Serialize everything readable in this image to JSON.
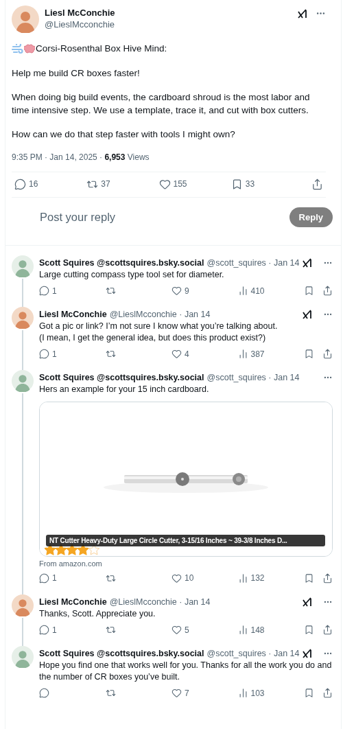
{
  "post": {
    "author": {
      "name": "Liesl McConchie",
      "handle": "@LieslMcconchie"
    },
    "title": "Corsi-Rosenthal Box Hive Mind:",
    "paragraphs": [
      "Help me build CR boxes faster!",
      "When doing big build events, the cardboard shroud is the most labor and time intensive step. We use a template, trace it, and cut with box cutters.",
      "How can we do that step faster with tools I might own?"
    ],
    "time": "9:35 PM · Jan 14, 2025 · ",
    "views": "6,953",
    "views_label": " Views",
    "actions": [
      {
        "kind": "reply",
        "count": "16"
      },
      {
        "kind": "repost",
        "count": "37"
      },
      {
        "kind": "like",
        "count": "155"
      },
      {
        "kind": "bookmark",
        "count": "33"
      },
      {
        "kind": "share"
      }
    ]
  },
  "composer": {
    "placeholder": "Post your reply",
    "button": "Reply",
    "disabled": true
  },
  "replies": [
    {
      "name": "Scott Squires @scottsquires.bsky.social",
      "handle": "@scott_squires · Jan 14",
      "kind": "sketch",
      "grok": true,
      "text": [
        "Large cutting compass type tool set for diameter."
      ],
      "actions": [
        {
          "kind": "reply",
          "count": "1"
        },
        {
          "kind": "repost"
        },
        {
          "kind": "like",
          "count": "9"
        },
        {
          "kind": "views",
          "count": "410"
        },
        {
          "kind": "bookmark"
        },
        {
          "kind": "share"
        }
      ]
    },
    {
      "name": "Liesl McConchie",
      "handle": "@LieslMcconchie · Jan 14",
      "grok": true,
      "text": [
        "Got a pic or link? I’m not sure I know what you’re talking about.",
        "(I mean, I get the general idea, but does this product exist?)"
      ],
      "actions": [
        {
          "kind": "reply",
          "count": "1"
        },
        {
          "kind": "repost"
        },
        {
          "kind": "like",
          "count": "4"
        },
        {
          "kind": "views",
          "count": "387"
        },
        {
          "kind": "bookmark"
        },
        {
          "kind": "share"
        }
      ]
    },
    {
      "name": "Scott Squires @scottsquires.bsky.social",
      "handle": "@scott_squires · Jan 14",
      "kind": "sketch",
      "grok": false,
      "text": [
        "Hers an example for your 15 inch cardboard."
      ],
      "card": {
        "kind": "picture",
        "caption": "NT Cutter Heavy-Duty Large Circle Cutter, 3-15/16 Inches ~ 39-3/8 Inches D...",
        "stars": 4,
        "source": "From amazon.com"
      },
      "actions": [
        {
          "kind": "reply",
          "count": "1"
        },
        {
          "kind": "repost"
        },
        {
          "kind": "like",
          "count": "10"
        },
        {
          "kind": "views",
          "count": "132"
        },
        {
          "kind": "bookmark"
        },
        {
          "kind": "share"
        }
      ]
    },
    {
      "name": "Liesl McConchie",
      "handle": "@LieslMcconchie · Jan 14",
      "grok": true,
      "text": [
        "Thanks, Scott. Appreciate you."
      ],
      "actions": [
        {
          "kind": "reply",
          "count": "1"
        },
        {
          "kind": "repost"
        },
        {
          "kind": "like",
          "count": "5"
        },
        {
          "kind": "views",
          "count": "148"
        },
        {
          "kind": "bookmark"
        },
        {
          "kind": "share"
        }
      ]
    },
    {
      "name": "Scott Squires @scottsquires.bsky.social",
      "handle": "@scott_squires · Jan 14",
      "kind": "sketch",
      "grok": true,
      "text": [
        "Hope you find one that works well for you. Thanks for all the work you do and the number of CR boxes you’ve built."
      ],
      "actions": [
        {
          "kind": "reply"
        },
        {
          "kind": "repost"
        },
        {
          "kind": "like",
          "count": "7"
        },
        {
          "kind": "views",
          "count": "103"
        },
        {
          "kind": "bookmark"
        },
        {
          "kind": "share"
        }
      ]
    }
  ]
}
